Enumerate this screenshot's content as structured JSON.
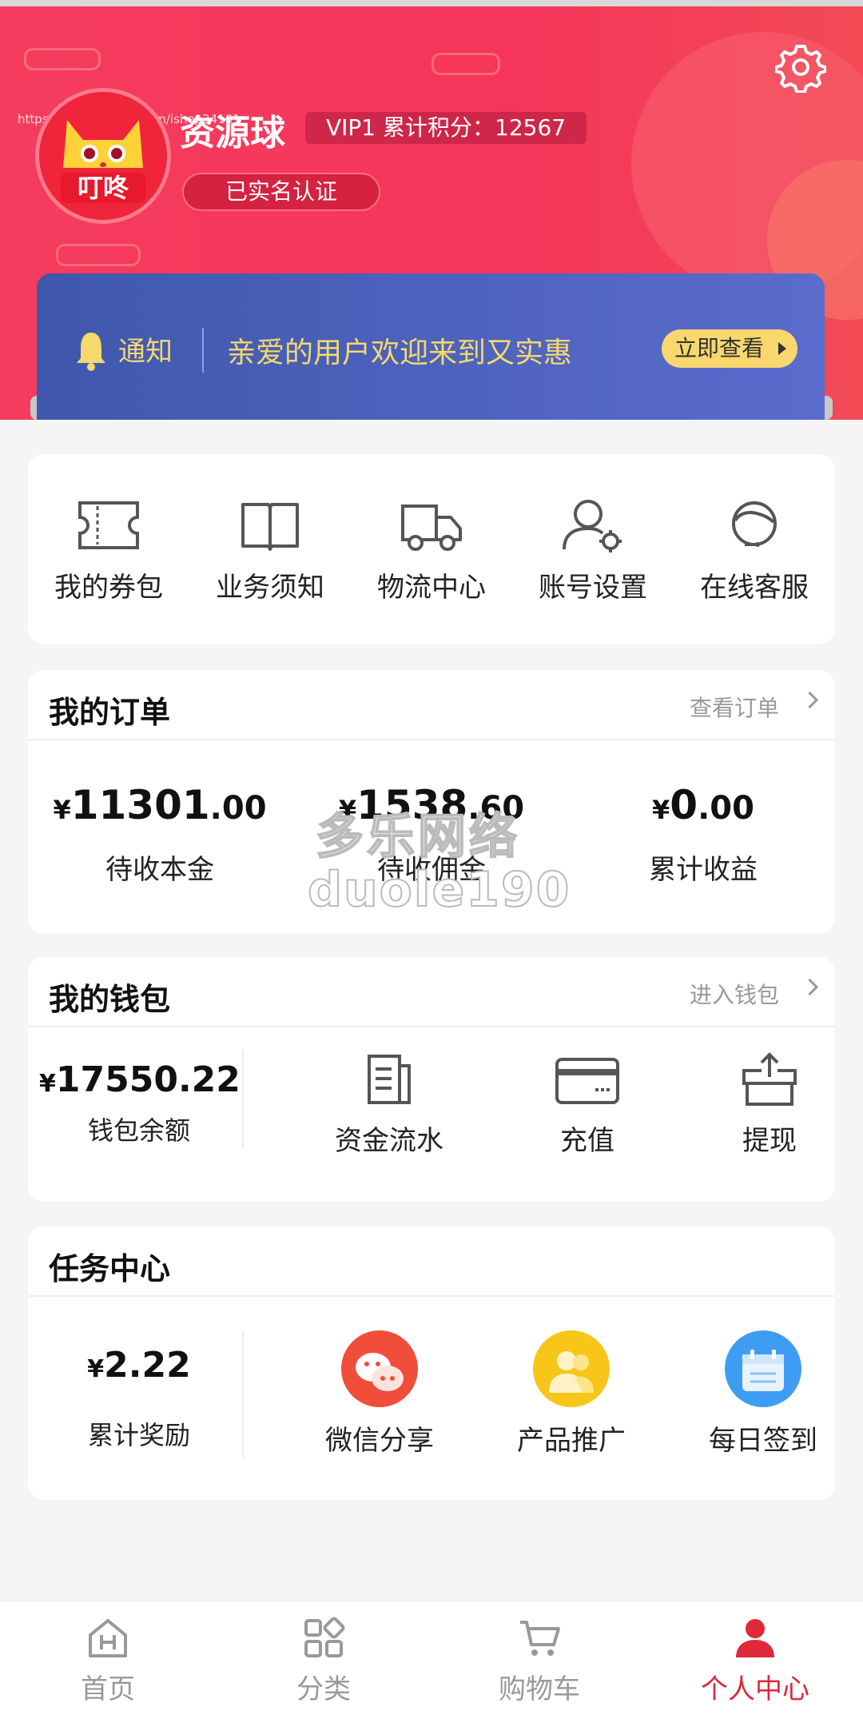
{
  "header": {
    "watermark_url": "https://www.huzhan.com/ishop34101",
    "username": "资源球",
    "vip_text": "VIP1 累计积分：12567",
    "verified_text": "已实名认证",
    "avatar_text": "叮咚",
    "settings_icon": "gear-icon"
  },
  "notice": {
    "label": "通知",
    "text": "亲爱的用户欢迎来到又实惠",
    "button": "立即查看"
  },
  "quick_menu": [
    {
      "label": "我的券包",
      "icon": "ticket-icon"
    },
    {
      "label": "业务须知",
      "icon": "book-icon"
    },
    {
      "label": "物流中心",
      "icon": "truck-icon"
    },
    {
      "label": "账号设置",
      "icon": "user-gear-icon"
    },
    {
      "label": "在线客服",
      "icon": "headset-icon"
    }
  ],
  "orders": {
    "title": "我的订单",
    "link": "查看订单",
    "items": [
      {
        "currency": "¥",
        "int": "11301",
        "dec": ".00",
        "label": "待收本金"
      },
      {
        "currency": "¥",
        "int": "1538",
        "dec": ".60",
        "label": "待收佣金"
      },
      {
        "currency": "¥",
        "int": "0",
        "dec": ".00",
        "label": "累计收益"
      }
    ],
    "watermark_line1": "多乐网络",
    "watermark_line2": "duole190"
  },
  "wallet": {
    "title": "我的钱包",
    "link": "进入钱包",
    "currency": "¥",
    "balance": "17550.22",
    "balance_label": "钱包余额",
    "actions": [
      {
        "label": "资金流水",
        "icon": "document-icon"
      },
      {
        "label": "充值",
        "icon": "card-icon"
      },
      {
        "label": "提现",
        "icon": "withdraw-icon"
      }
    ]
  },
  "tasks": {
    "title": "任务中心",
    "currency": "¥",
    "reward": "2.22",
    "reward_label": "累计奖励",
    "items": [
      {
        "label": "微信分享",
        "icon": "wechat-icon",
        "color": "#f04e3a"
      },
      {
        "label": "产品推广",
        "icon": "users-icon",
        "color": "#f8c619"
      },
      {
        "label": "每日签到",
        "icon": "calendar-icon",
        "color": "#3e9df3"
      }
    ]
  },
  "tabbar": {
    "items": [
      {
        "label": "首页",
        "icon": "home-icon"
      },
      {
        "label": "分类",
        "icon": "category-icon"
      },
      {
        "label": "购物车",
        "icon": "cart-icon"
      },
      {
        "label": "个人中心",
        "icon": "person-icon"
      }
    ],
    "active_color": "#e0283a",
    "inactive_color": "#999999"
  },
  "colors": {
    "header_red": "#f53c5e",
    "notice_blue": "#4a60b8",
    "notice_gold": "#f4d96b"
  }
}
